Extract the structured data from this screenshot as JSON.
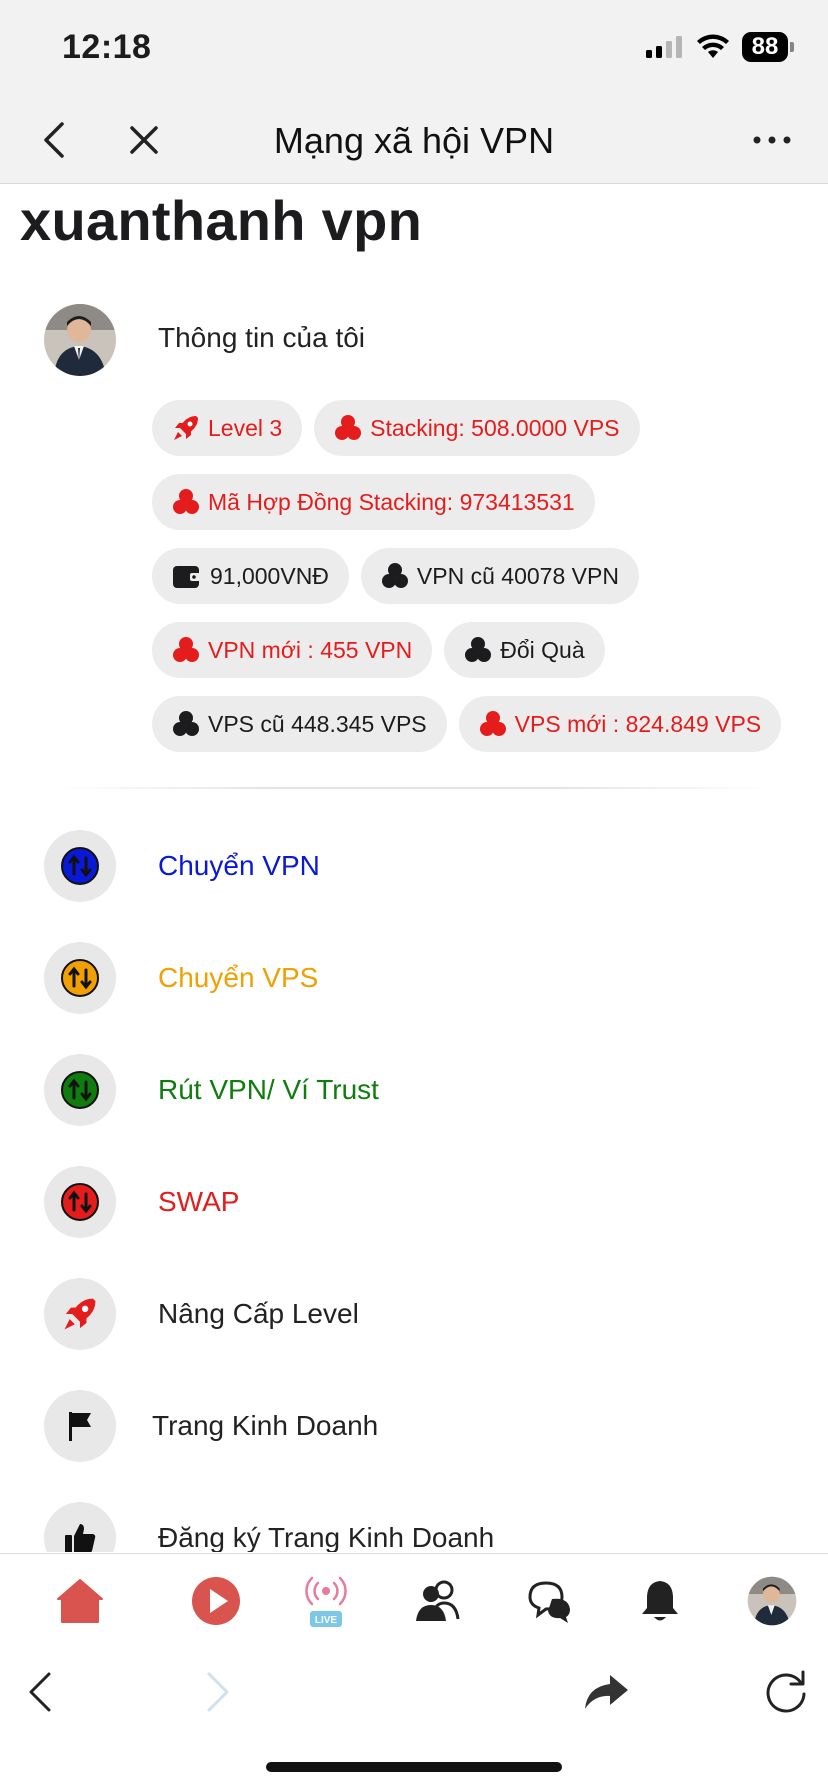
{
  "status_bar": {
    "time": "12:18",
    "battery": "88"
  },
  "nav": {
    "title": "Mạng xã hội VPN"
  },
  "profile": {
    "name": "xuanthanh vpn",
    "info_label": "Thông tin của tôi"
  },
  "chips": [
    {
      "label": "Level 3",
      "style": "red",
      "icon": "rocket-icon"
    },
    {
      "label": "Stacking: 508.0000 VPS",
      "style": "red",
      "icon": "coins-icon"
    },
    {
      "label": "Mã Hợp Đồng Stacking: 973413531",
      "style": "red",
      "icon": "coins-icon"
    },
    {
      "label": "91,000VNĐ",
      "style": "dark",
      "icon": "wallet-icon"
    },
    {
      "label": "VPN cũ 40078 VPN",
      "style": "dark",
      "icon": "coins-icon"
    },
    {
      "label": "VPN mới : 455 VPN",
      "style": "red",
      "icon": "coins-icon"
    },
    {
      "label": "Đổi Quà",
      "style": "dark",
      "icon": "coins-icon"
    },
    {
      "label": "VPS cũ 448.345 VPS",
      "style": "dark",
      "icon": "coins-icon"
    },
    {
      "label": "VPS mới : 824.849 VPS",
      "style": "red",
      "icon": "coins-icon"
    }
  ],
  "menu": [
    {
      "label": "Chuyển VPN",
      "color": "#0a18d8",
      "icon": "transfer-icon"
    },
    {
      "label": "Chuyển VPS",
      "color": "#f0a000",
      "icon": "transfer-icon"
    },
    {
      "label": "Rút VPN/ Ví Trust",
      "color": "#0e7d0e",
      "icon": "transfer-icon"
    },
    {
      "label": "SWAP",
      "color": "#e51c1c",
      "icon": "transfer-icon"
    },
    {
      "label": "Nâng Cấp Level",
      "color": "#222222",
      "icon": "rocket-icon"
    },
    {
      "label": "Trang Kinh Doanh",
      "color": "#222222",
      "icon": "flag-icon"
    },
    {
      "label": "Đăng ký Trang Kinh Doanh",
      "color": "#222222",
      "icon": "thumbs-up-icon"
    }
  ],
  "tabbar": {
    "live_badge": "LIVE"
  },
  "colors": {
    "accent_red": "#e51c1c",
    "chip_bg": "#ececec",
    "tab_red": "#d9534f"
  }
}
